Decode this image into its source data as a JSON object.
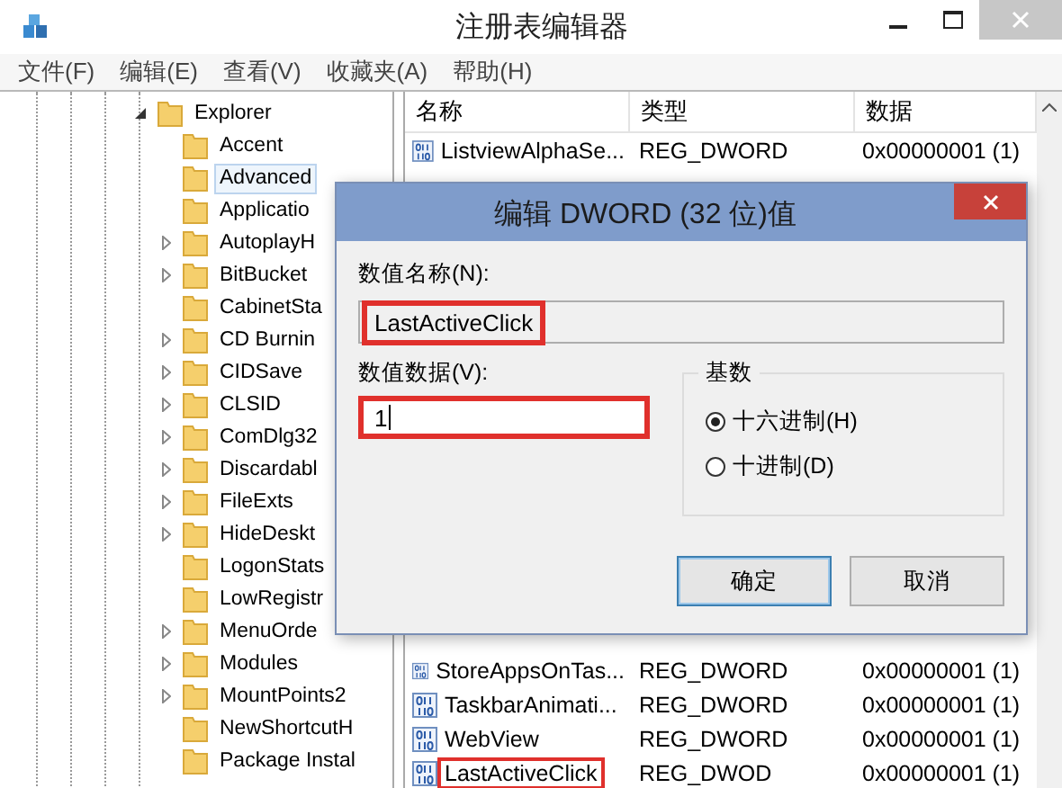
{
  "window": {
    "title": "注册表编辑器"
  },
  "menu": [
    "文件(F)",
    "编辑(E)",
    "查看(V)",
    "收藏夹(A)",
    "帮助(H)"
  ],
  "tree": {
    "label": "Explorer",
    "expanded": true,
    "children": [
      {
        "label": "Accent",
        "expandable": false,
        "selected": false
      },
      {
        "label": "Advanced",
        "expandable": false,
        "selected": true
      },
      {
        "label": "Applicatio",
        "expandable": false,
        "selected": false
      },
      {
        "label": "AutoplayH",
        "expandable": true,
        "selected": false
      },
      {
        "label": "BitBucket",
        "expandable": true,
        "selected": false
      },
      {
        "label": "CabinetSta",
        "expandable": false,
        "selected": false
      },
      {
        "label": "CD Burnin",
        "expandable": true,
        "selected": false
      },
      {
        "label": "CIDSave",
        "expandable": true,
        "selected": false
      },
      {
        "label": "CLSID",
        "expandable": true,
        "selected": false
      },
      {
        "label": "ComDlg32",
        "expandable": true,
        "selected": false
      },
      {
        "label": "Discardabl",
        "expandable": true,
        "selected": false
      },
      {
        "label": "FileExts",
        "expandable": true,
        "selected": false
      },
      {
        "label": "HideDeskt",
        "expandable": true,
        "selected": false
      },
      {
        "label": "LogonStats",
        "expandable": false,
        "selected": false
      },
      {
        "label": "LowRegistr",
        "expandable": false,
        "selected": false
      },
      {
        "label": "MenuOrde",
        "expandable": true,
        "selected": false
      },
      {
        "label": "Modules",
        "expandable": true,
        "selected": false
      },
      {
        "label": "MountPoints2",
        "expandable": true,
        "selected": false
      },
      {
        "label": "NewShortcutH",
        "expandable": false,
        "selected": false
      },
      {
        "label": "Package Instal",
        "expandable": false,
        "selected": false
      }
    ]
  },
  "table": {
    "columns": [
      "名称",
      "类型",
      "数据"
    ],
    "rows_top": [
      {
        "name": "ListviewAlphaSe...",
        "type": "REG_DWORD",
        "data": "0x00000001 (1)",
        "highlighted": false
      }
    ],
    "rows_bottom": [
      {
        "name": "StoreAppsOnTas...",
        "type": "REG_DWORD",
        "data": "0x00000001 (1)",
        "highlighted": false
      },
      {
        "name": "TaskbarAnimati...",
        "type": "REG_DWORD",
        "data": "0x00000001 (1)",
        "highlighted": false
      },
      {
        "name": "WebView",
        "type": "REG_DWORD",
        "data": "0x00000001 (1)",
        "highlighted": false
      },
      {
        "name": "LastActiveClick",
        "type": "REG_DWOD",
        "data": "0x00000001 (1)",
        "highlighted": true
      }
    ]
  },
  "dialog": {
    "title": "编辑 DWORD (32 位)值",
    "name_label": "数值名称(N):",
    "name_value": "LastActiveClick",
    "name_highlighted": true,
    "data_label": "数值数据(V):",
    "data_value": "1",
    "data_highlighted": true,
    "base": {
      "title": "基数",
      "options": [
        {
          "label": "十六进制(H)",
          "selected": true
        },
        {
          "label": "十进制(D)",
          "selected": false
        }
      ]
    },
    "buttons": [
      {
        "label": "确定",
        "default": true
      },
      {
        "label": "取消",
        "default": false
      }
    ]
  }
}
